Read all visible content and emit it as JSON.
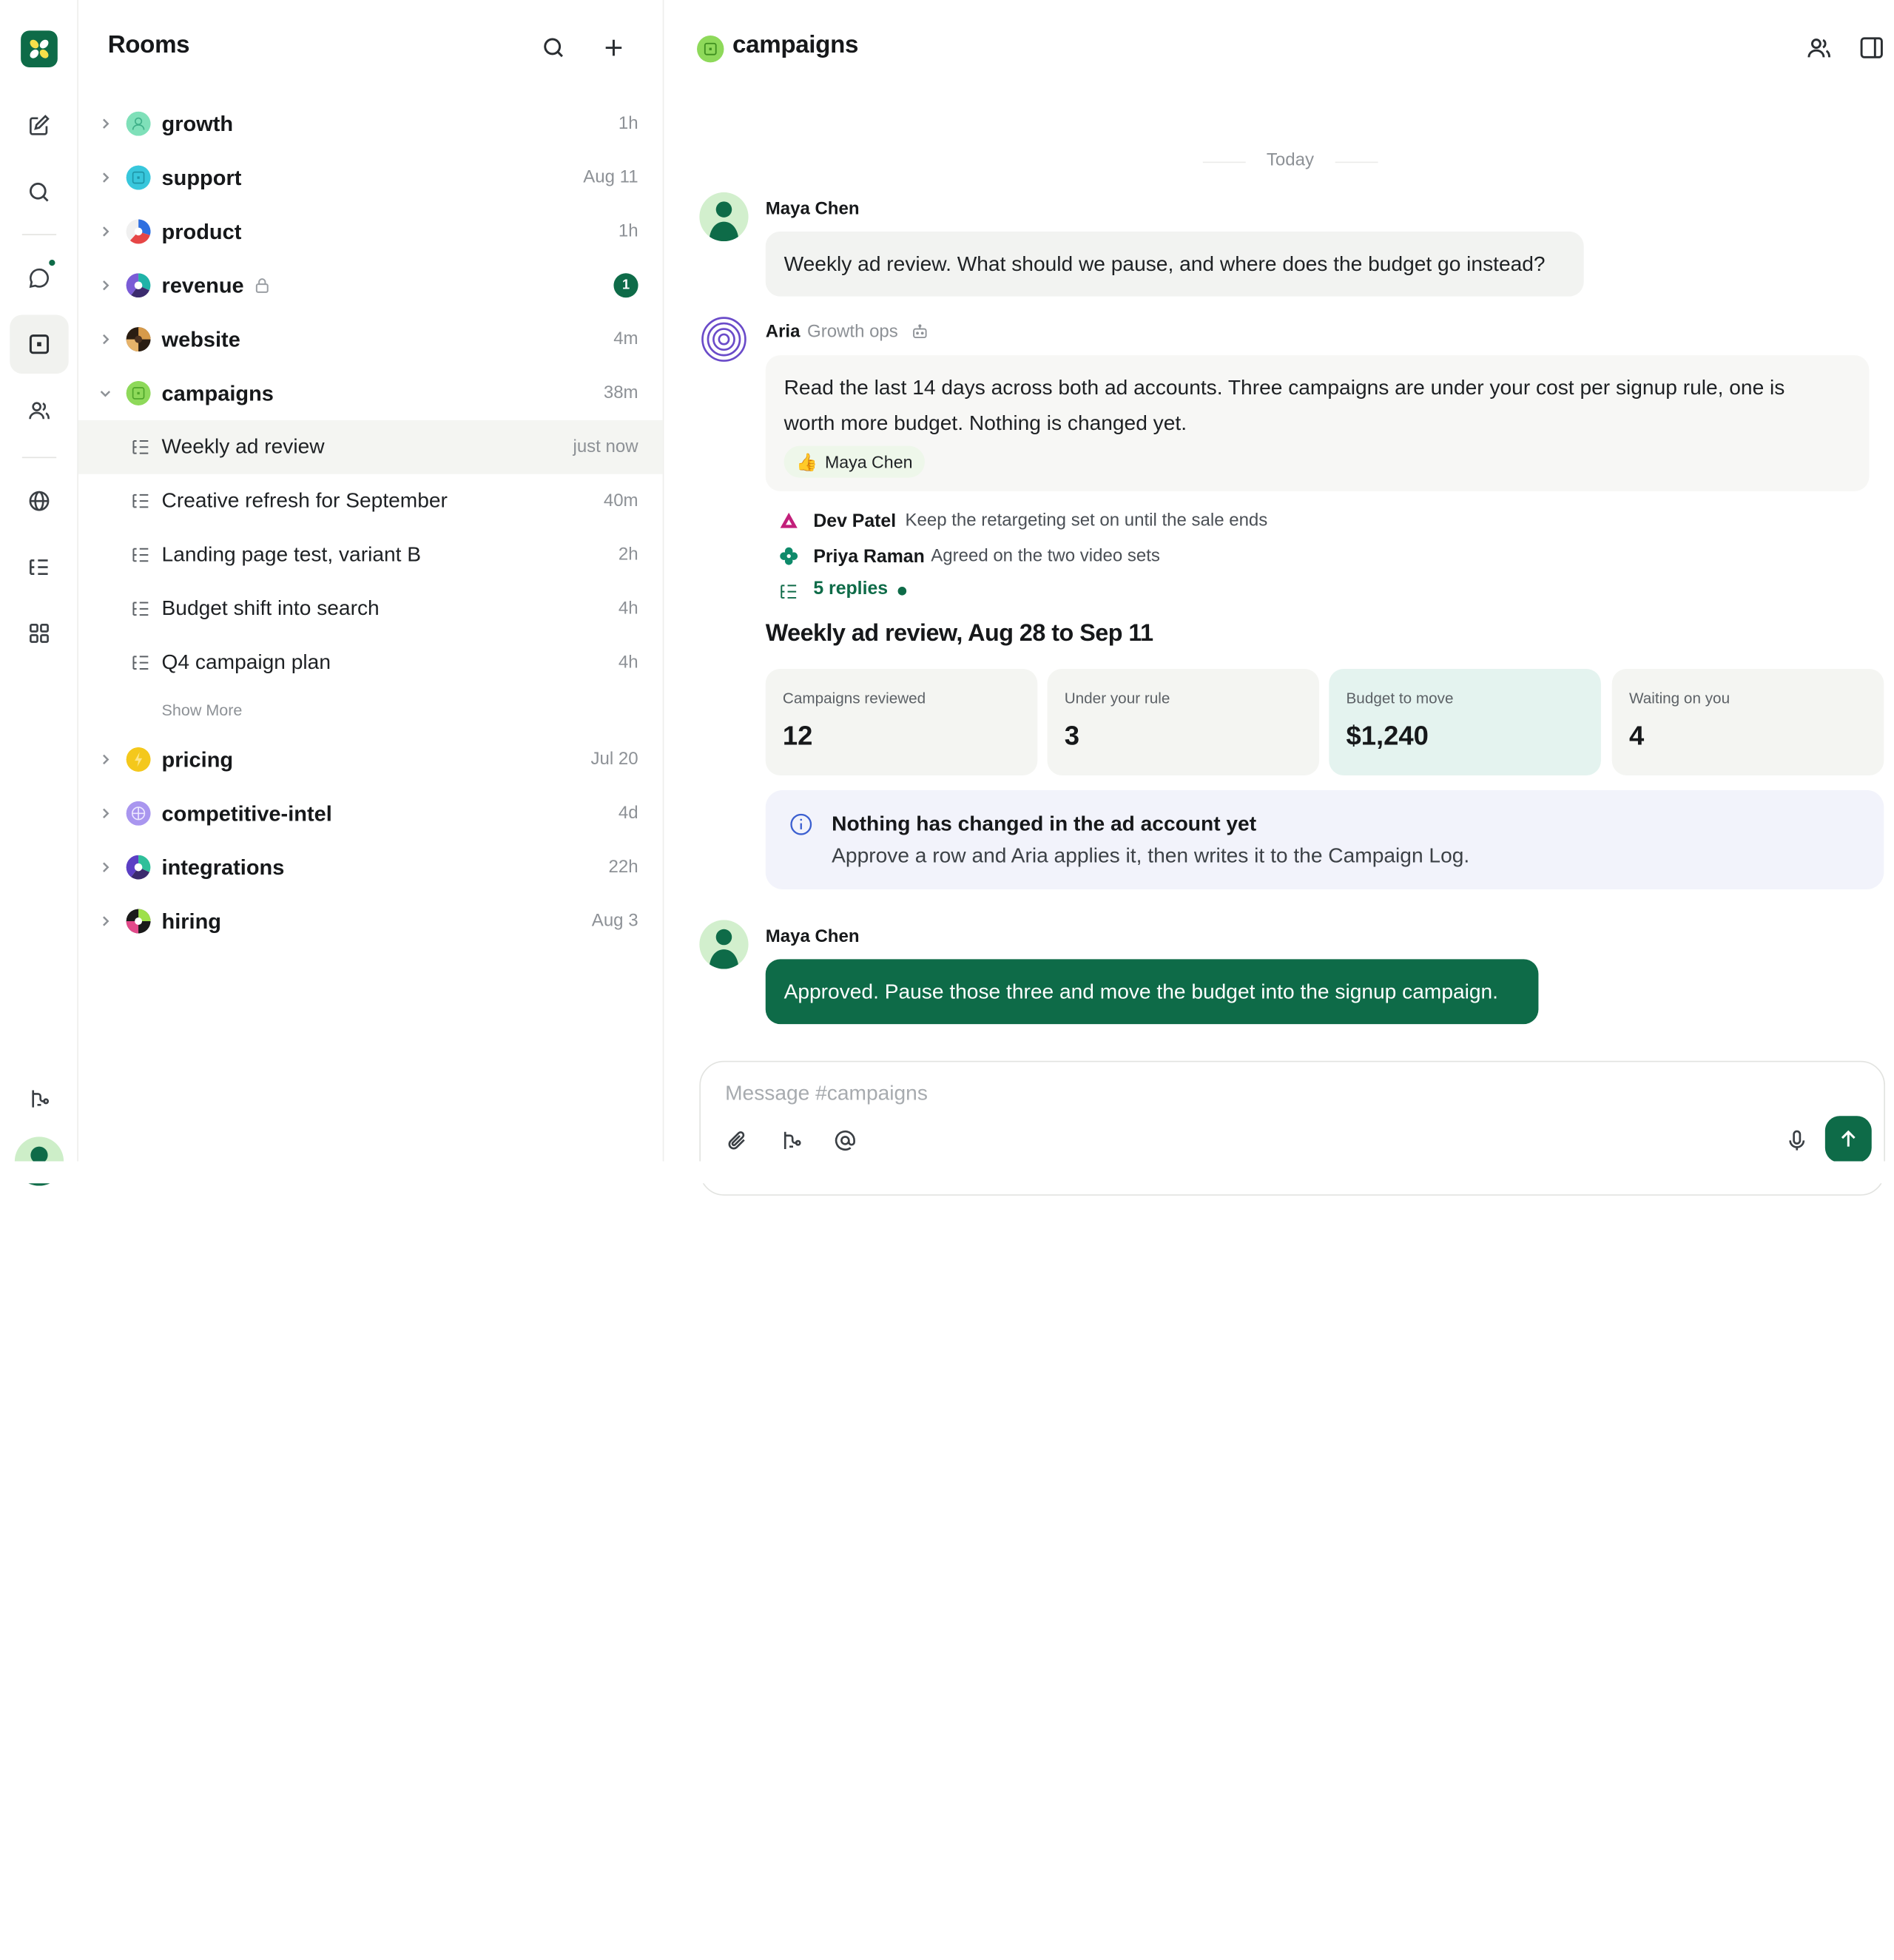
{
  "colors": {
    "brand": "#0e6b48",
    "selected_row": "#f4f5f2",
    "muted_text": "#8d9196",
    "notice_bg": "#f2f3fb",
    "stat_highlight_bg": "#e4f3ef"
  },
  "rail": {
    "icons": [
      "app-logo-icon",
      "compose-icon",
      "search-icon",
      "chat-icon",
      "rooms-icon",
      "people-icon",
      "globe-icon",
      "threads-icon",
      "apps-grid-icon",
      "workflow-icon"
    ],
    "active": "rooms-icon"
  },
  "rooms_panel": {
    "title": "Rooms",
    "show_more": "Show More",
    "rooms_top": [
      {
        "name": "growth",
        "time": "1h"
      },
      {
        "name": "support",
        "time": "Aug 11"
      },
      {
        "name": "product",
        "time": "1h"
      },
      {
        "name": "revenue",
        "time": "",
        "badge": "1",
        "locked": true
      },
      {
        "name": "website",
        "time": "4m"
      },
      {
        "name": "campaigns",
        "time": "38m",
        "expanded": true
      }
    ],
    "threads": [
      {
        "name": "Weekly ad review",
        "time": "just now",
        "selected": true
      },
      {
        "name": "Creative refresh for September",
        "time": "40m"
      },
      {
        "name": "Landing page test, variant B",
        "time": "2h"
      },
      {
        "name": "Budget shift into search",
        "time": "4h"
      },
      {
        "name": "Q4 campaign plan",
        "time": "4h"
      }
    ],
    "rooms_bottom": [
      {
        "name": "pricing",
        "time": "Jul 20"
      },
      {
        "name": "competitive-intel",
        "time": "4d"
      },
      {
        "name": "integrations",
        "time": "22h"
      },
      {
        "name": "hiring",
        "time": "Aug 3"
      }
    ]
  },
  "channel": {
    "name": "campaigns",
    "day_label": "Today"
  },
  "messages": {
    "m1": {
      "author": "Maya Chen",
      "text": "Weekly ad review. What should we pause, and where does the budget go instead?"
    },
    "m2": {
      "author": "Aria",
      "role": "Growth ops",
      "text_line1": "Read the last 14 days across both ad accounts. Three campaigns are under your cost per signup rule, one is",
      "text_line2": "worth more budget. Nothing is changed yet.",
      "reaction_emoji": "👍",
      "reaction_name": "Maya Chen",
      "replies": [
        {
          "name": "Dev Patel",
          "text": "Keep the retargeting set on until the sale ends"
        },
        {
          "name": "Priya Raman",
          "text": "Agreed on the two video sets"
        }
      ],
      "replies_link": "5 replies"
    },
    "summary": {
      "title": "Weekly ad review, Aug 28 to Sep 11",
      "stats": [
        {
          "label": "Campaigns reviewed",
          "value": "12"
        },
        {
          "label": "Under your rule",
          "value": "3"
        },
        {
          "label": "Budget to move",
          "value": "$1,240"
        },
        {
          "label": "Waiting on you",
          "value": "4"
        }
      ],
      "notice_title": "Nothing has changed in the ad account yet",
      "notice_body": "Approve a row and Aria applies it, then writes it to the Campaign Log."
    },
    "m3": {
      "author": "Maya Chen",
      "text": "Approved. Pause those three and move the budget into the signup campaign."
    }
  },
  "composer": {
    "placeholder": "Message #campaigns"
  }
}
